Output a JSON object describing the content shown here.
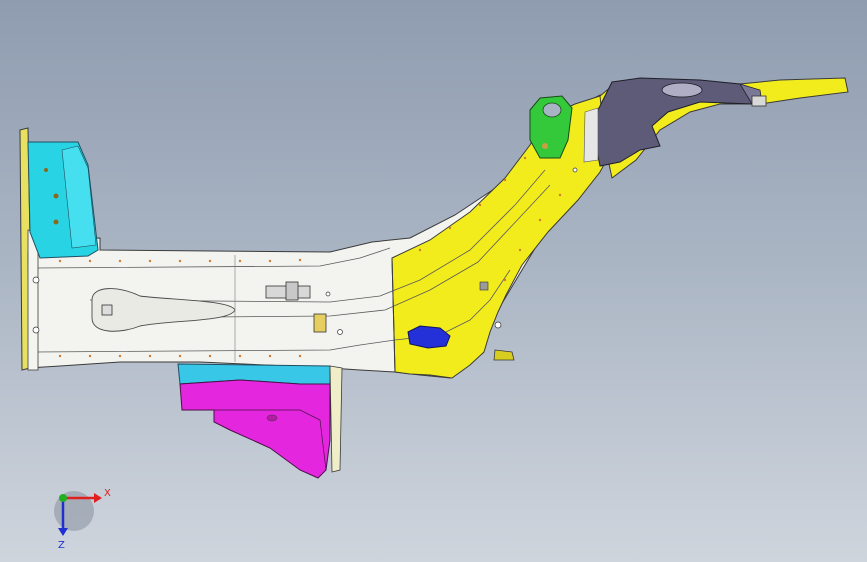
{
  "viewport": {
    "background_top": "#8f9cb0",
    "background_bottom": "#cfd5dd"
  },
  "model": {
    "part_colors": {
      "main_rail": "#f3f3ef",
      "rail_front_flange": "#e8e060",
      "cyan_bracket": "#28d4e4",
      "yellow_rail": "#f2ec1c",
      "green_bracket": "#34c93a",
      "dark_shock_tower": "#5d5b78",
      "cyan_lower_bracket": "#39c7e8",
      "magenta_bracket": "#e427de",
      "blue_clip": "#2430d8",
      "edge": "#2b2b2b"
    }
  },
  "triad": {
    "x_label": "X",
    "z_label": "Z",
    "x_color": "#e02020",
    "y_color": "#20b020",
    "z_color": "#2030d0"
  }
}
